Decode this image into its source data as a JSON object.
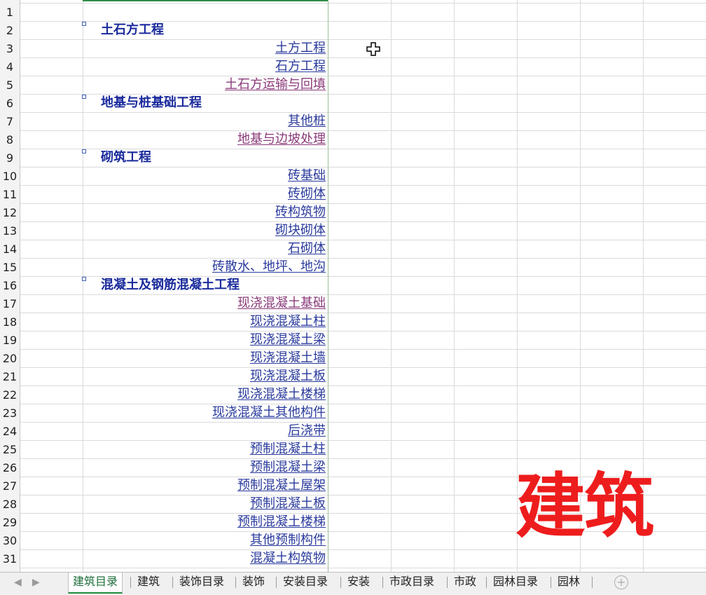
{
  "rows": [
    {
      "num": "1",
      "text": "",
      "kind": "empty"
    },
    {
      "num": "2",
      "text": "土石方工程",
      "kind": "heading"
    },
    {
      "num": "3",
      "text": "土方工程",
      "kind": "link"
    },
    {
      "num": "4",
      "text": "石方工程",
      "kind": "link"
    },
    {
      "num": "5",
      "text": "土石方运输与回填",
      "kind": "visited"
    },
    {
      "num": "6",
      "text": "地基与桩基础工程",
      "kind": "heading"
    },
    {
      "num": "7",
      "text": "其他桩",
      "kind": "link"
    },
    {
      "num": "8",
      "text": "地基与边坡处理",
      "kind": "visited"
    },
    {
      "num": "9",
      "text": "砌筑工程",
      "kind": "heading"
    },
    {
      "num": "10",
      "text": "砖基础",
      "kind": "link"
    },
    {
      "num": "11",
      "text": "砖砌体",
      "kind": "link"
    },
    {
      "num": "12",
      "text": "砖构筑物",
      "kind": "link"
    },
    {
      "num": "13",
      "text": "砌块砌体",
      "kind": "link"
    },
    {
      "num": "14",
      "text": "石砌体",
      "kind": "link"
    },
    {
      "num": "15",
      "text": "砖散水、地坪、地沟",
      "kind": "link"
    },
    {
      "num": "16",
      "text": "混凝土及钢筋混凝土工程",
      "kind": "heading"
    },
    {
      "num": "17",
      "text": "现浇混凝土基础",
      "kind": "visited"
    },
    {
      "num": "18",
      "text": "现浇混凝土柱",
      "kind": "link"
    },
    {
      "num": "19",
      "text": "现浇混凝土梁",
      "kind": "link"
    },
    {
      "num": "20",
      "text": "现浇混凝土墙",
      "kind": "link"
    },
    {
      "num": "21",
      "text": "现浇混凝土板",
      "kind": "link"
    },
    {
      "num": "22",
      "text": "现浇混凝土楼梯",
      "kind": "link"
    },
    {
      "num": "23",
      "text": "现浇混凝土其他构件",
      "kind": "link"
    },
    {
      "num": "24",
      "text": "后浇带",
      "kind": "link"
    },
    {
      "num": "25",
      "text": "预制混凝土柱",
      "kind": "link"
    },
    {
      "num": "26",
      "text": "预制混凝土梁",
      "kind": "link"
    },
    {
      "num": "27",
      "text": "预制混凝土屋架",
      "kind": "link"
    },
    {
      "num": "28",
      "text": "预制混凝土板",
      "kind": "link"
    },
    {
      "num": "29",
      "text": "预制混凝土楼梯",
      "kind": "link"
    },
    {
      "num": "30",
      "text": "其他预制构件",
      "kind": "link"
    },
    {
      "num": "31",
      "text": "混凝土构筑物",
      "kind": "link"
    }
  ],
  "watermark": "建筑",
  "tabs": [
    {
      "label": "建筑目录",
      "active": true
    },
    {
      "label": "建筑",
      "active": false
    },
    {
      "label": "装饰目录",
      "active": false
    },
    {
      "label": "装饰",
      "active": false
    },
    {
      "label": "安装目录",
      "active": false
    },
    {
      "label": "安装",
      "active": false
    },
    {
      "label": "市政目录",
      "active": false
    },
    {
      "label": "市政",
      "active": false
    },
    {
      "label": "园林目录",
      "active": false
    },
    {
      "label": "园林",
      "active": false
    }
  ],
  "nav": {
    "prev_icon": "triangle-left-icon",
    "next_icon": "triangle-right-icon",
    "add_icon": "plus-circle-icon"
  },
  "colors": {
    "heading": "#1a2a9c",
    "link": "#2a3a9c",
    "visited": "#8a3a7a",
    "watermark": "#ee1d1d",
    "active_tab": "#1d8b3c"
  }
}
